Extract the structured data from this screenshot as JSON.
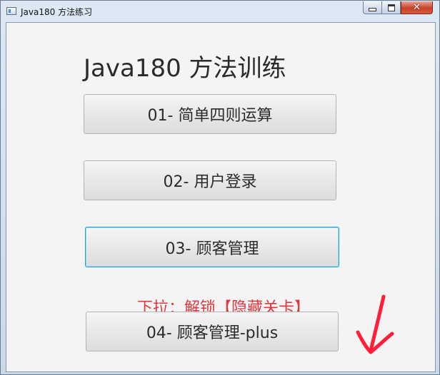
{
  "window": {
    "title": "Java180 方法练习",
    "controls": {
      "minimize": "minimize",
      "maximize": "maximize",
      "close": "✕"
    }
  },
  "main": {
    "heading": "Java180 方法训练",
    "buttons": [
      {
        "label": "01- 简单四则运算"
      },
      {
        "label": "02- 用户登录"
      },
      {
        "label": "03- 顾客管理"
      },
      {
        "label": "04- 顾客管理-plus"
      }
    ],
    "hint": "下拉：解锁【隐藏关卡】",
    "focused_button_index": 2
  },
  "colors": {
    "hint": "#e1373f",
    "arrow": "#ff1f3a",
    "focus_border": "#1fa0dd",
    "background": "#f4f4f4"
  },
  "icons": {
    "app": "app-window-icon",
    "arrow": "hand-drawn-down-arrow"
  }
}
